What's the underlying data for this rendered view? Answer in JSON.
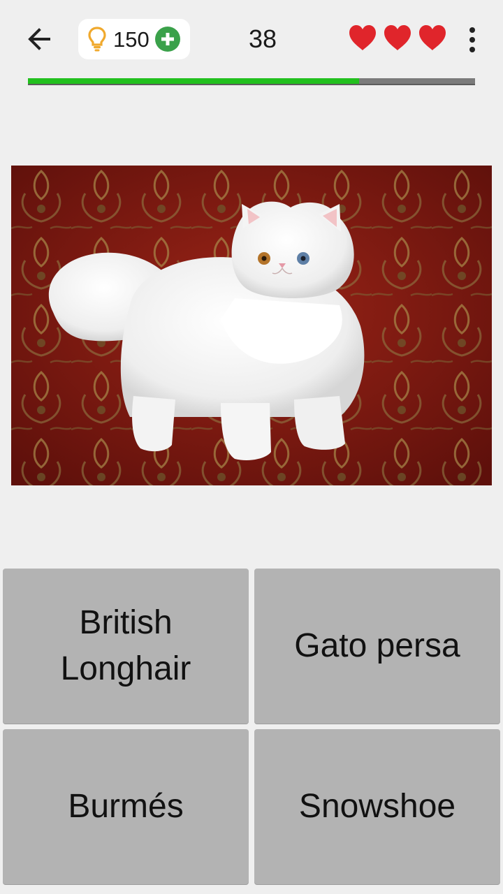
{
  "toolbar": {
    "back_icon": "arrow-left-icon",
    "hints_icon": "lightbulb-icon",
    "hints_count": "150",
    "add_hints_icon": "plus-circle-icon",
    "question_number": "38",
    "lives_icon": "heart-icon",
    "lives": 3,
    "menu_icon": "more-vert-icon"
  },
  "progress": {
    "fraction": 0.74,
    "fill_color": "#22c01e",
    "track_color": "#7b7b7b"
  },
  "question": {
    "image_icon": "white-persian-cat-photo"
  },
  "answers": [
    {
      "label": "British Longhair"
    },
    {
      "label": "Gato persa"
    },
    {
      "label": "Burmés"
    },
    {
      "label": "Snowshoe"
    }
  ],
  "colors": {
    "background": "#efefef",
    "button": "#b3b3b3",
    "heart": "#e0252b",
    "plus": "#3aa14a",
    "bulb": "#f0a92d"
  }
}
